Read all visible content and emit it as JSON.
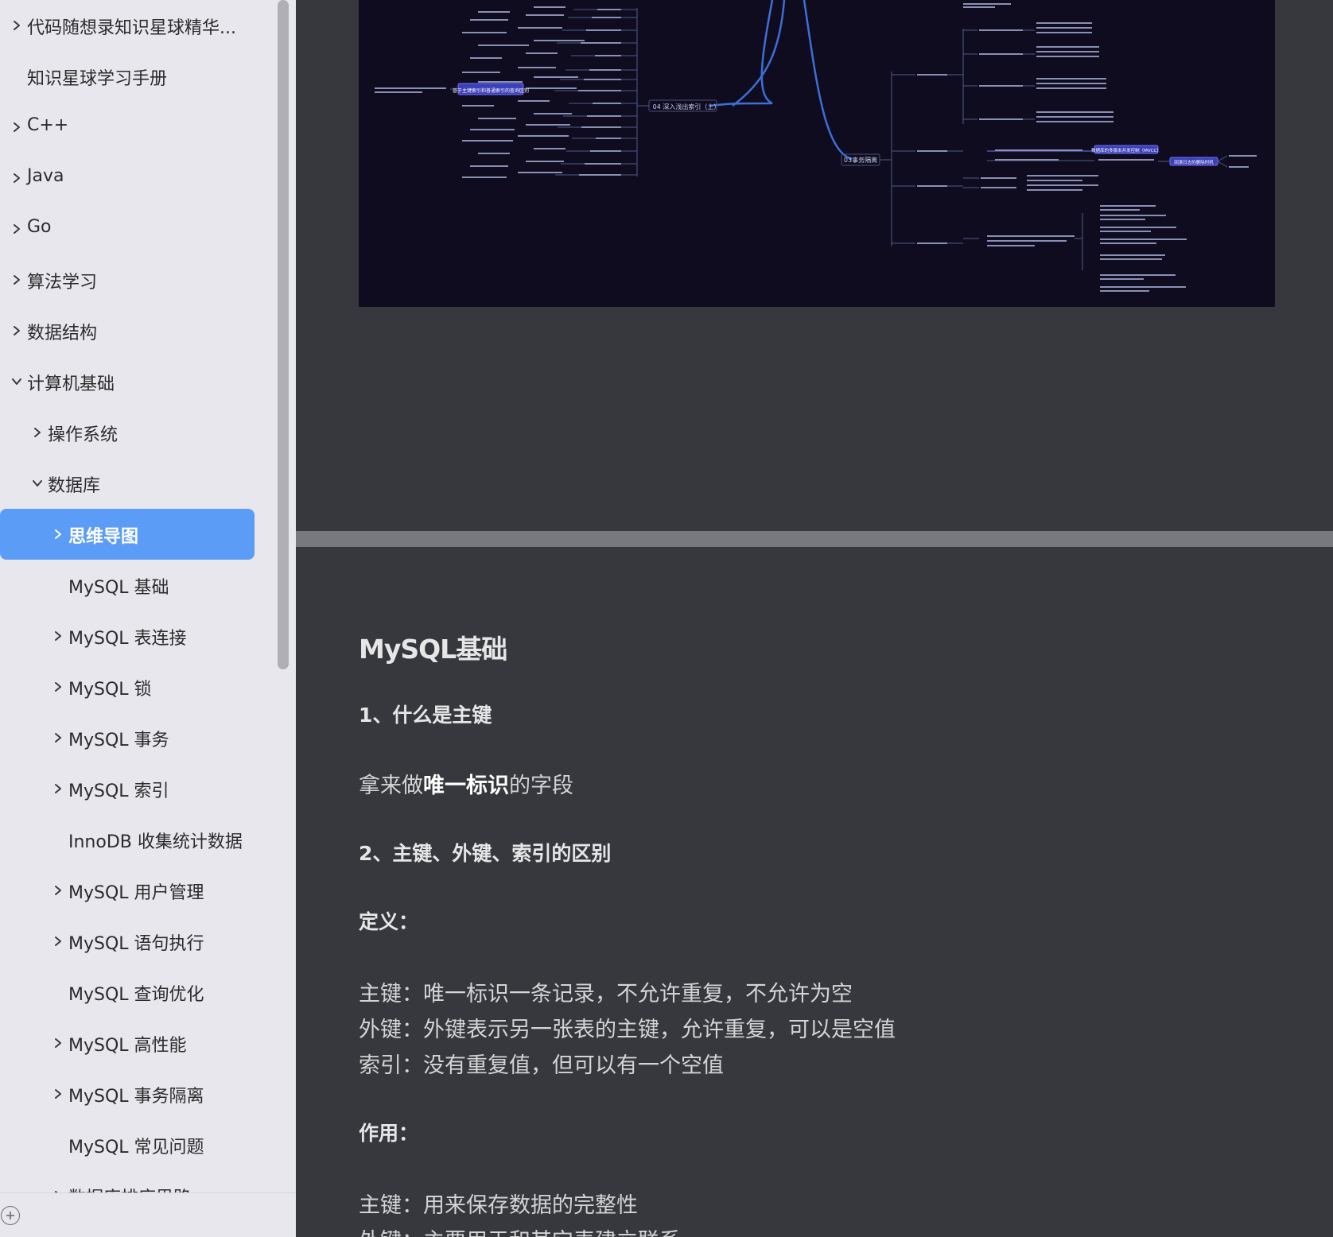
{
  "sidebar": {
    "items": [
      {
        "label": "代码随想录知识星球精华...",
        "has_chevron": true,
        "expanded": false
      },
      {
        "label": "知识星球学习手册",
        "has_chevron": false
      },
      {
        "label": "C++",
        "has_chevron": true,
        "expanded": false
      },
      {
        "label": "Java",
        "has_chevron": true,
        "expanded": false
      },
      {
        "label": "Go",
        "has_chevron": true,
        "expanded": false
      },
      {
        "label": "算法学习",
        "has_chevron": true,
        "expanded": false
      },
      {
        "label": "数据结构",
        "has_chevron": true,
        "expanded": false
      },
      {
        "label": "计算机基础",
        "has_chevron": true,
        "expanded": true
      },
      {
        "label": "操作系统",
        "has_chevron": true,
        "expanded": false
      },
      {
        "label": "数据库",
        "has_chevron": true,
        "expanded": true
      },
      {
        "label": "思维导图",
        "has_chevron": true,
        "expanded": false,
        "active": true
      },
      {
        "label": "MySQL 基础",
        "has_chevron": false
      },
      {
        "label": "MySQL 表连接",
        "has_chevron": true,
        "expanded": false
      },
      {
        "label": "MySQL 锁",
        "has_chevron": true,
        "expanded": false
      },
      {
        "label": "MySQL 事务",
        "has_chevron": true,
        "expanded": false
      },
      {
        "label": "MySQL 索引",
        "has_chevron": true,
        "expanded": false
      },
      {
        "label": "InnoDB 收集统计数据",
        "has_chevron": false
      },
      {
        "label": "MySQL 用户管理",
        "has_chevron": true,
        "expanded": false
      },
      {
        "label": "MySQL 语句执行",
        "has_chevron": true,
        "expanded": false
      },
      {
        "label": "MySQL 查询优化",
        "has_chevron": false
      },
      {
        "label": "MySQL 高性能",
        "has_chevron": true,
        "expanded": false
      },
      {
        "label": "MySQL 事务隔离",
        "has_chevron": true,
        "expanded": false
      },
      {
        "label": "MySQL 常见问题",
        "has_chevron": false
      },
      {
        "label": "数据库排序思路",
        "has_chevron": true,
        "expanded": false
      }
    ],
    "active_color": "#5b9cf7"
  },
  "mindmap": {
    "nodes": {
      "center_left": "04 深入浅出索引（上）",
      "center_right": "03事务隔离",
      "left_main": "基于主键索引和普通索引的查询区别",
      "right_main": "数据库的多版本并发控制（MVCC）",
      "right_sub": "回滚日志的删除时机"
    },
    "background": "#0f0c1f"
  },
  "content": {
    "title": "MySQL基础",
    "q1": "1、什么是主键",
    "q1_answer_pre": "拿来做",
    "q1_answer_bold": "唯一标识",
    "q1_answer_post": "的字段",
    "q2": "2、主键、外键、索引的区别",
    "definition_heading": "定义：",
    "definitions": [
      "主键：唯一标识一条记录，不允许重复，不允许为空",
      "外键：外键表示另一张表的主键，允许重复，可以是空值",
      "索引：没有重复值，但可以有一个空值"
    ],
    "usage_heading": "作用：",
    "usages": [
      "主键：用来保存数据的完整性",
      "外键：主要用于和其它表建立联系"
    ]
  }
}
